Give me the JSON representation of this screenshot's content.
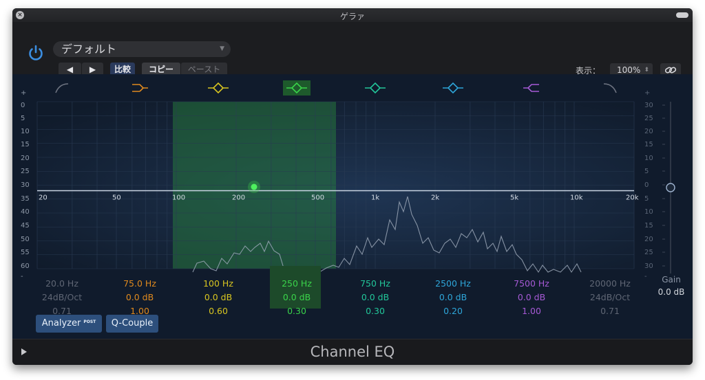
{
  "window": {
    "title": "ゲラァ"
  },
  "header": {
    "preset_name": "デフォルト",
    "prev_glyph": "◀",
    "next_glyph": "▶",
    "compare_label": "比較",
    "copy_label": "コピー",
    "paste_label": "ペースト",
    "view_label": "表示：",
    "zoom_value": "100%",
    "link_icon": "link-icon"
  },
  "graph": {
    "db_ticks": [
      "+",
      "0",
      "5",
      "10",
      "15",
      "20",
      "25",
      "30",
      "35",
      "40",
      "45",
      "50",
      "55",
      "60",
      "-"
    ],
    "gain_ticks": [
      "+",
      "30",
      "25",
      "20",
      "15",
      "10",
      "5",
      "0",
      "5",
      "10",
      "15",
      "20",
      "25",
      "30",
      "-"
    ],
    "freq_ticks": [
      "20",
      "50",
      "100",
      "200",
      "500",
      "1k",
      "2k",
      "5k",
      "10k",
      "20k"
    ],
    "highlight_color": "#2a8a3f",
    "active_band_index": 3
  },
  "bands": [
    {
      "name": "low-cut",
      "freq": "20.0 Hz",
      "gain": "24dB/Oct",
      "q": "0.71",
      "color": "#6d7380",
      "icon": "low-cut-icon"
    },
    {
      "name": "low-shelf",
      "freq": "75.0 Hz",
      "gain": "0.0 dB",
      "q": "1.00",
      "color": "#e08a1e",
      "icon": "low-shelf-icon"
    },
    {
      "name": "parametric-1",
      "freq": "100 Hz",
      "gain": "0.0 dB",
      "q": "0.60",
      "color": "#d9c620",
      "icon": "bell-icon"
    },
    {
      "name": "parametric-2",
      "freq": "250 Hz",
      "gain": "0.0 dB",
      "q": "0.30",
      "color": "#3ad44a",
      "icon": "bell-icon"
    },
    {
      "name": "parametric-3",
      "freq": "750 Hz",
      "gain": "0.0 dB",
      "q": "0.30",
      "color": "#22c79a",
      "icon": "bell-icon"
    },
    {
      "name": "parametric-4",
      "freq": "2500 Hz",
      "gain": "0.0 dB",
      "q": "0.20",
      "color": "#2ea6d9",
      "icon": "bell-icon"
    },
    {
      "name": "high-shelf",
      "freq": "7500 Hz",
      "gain": "0.0 dB",
      "q": "1.00",
      "color": "#a65ad6",
      "icon": "high-shelf-icon"
    },
    {
      "name": "high-cut",
      "freq": "20000 Hz",
      "gain": "24dB/Oct",
      "q": "0.71",
      "color": "#6d7380",
      "icon": "high-cut-icon"
    }
  ],
  "gain_control": {
    "label": "Gain",
    "value": "0.0 dB"
  },
  "toolbar": {
    "analyzer_label": "Analyzer",
    "analyzer_badge": "POST",
    "qcouple_label": "Q-Couple"
  },
  "footer": {
    "plugin_name": "Channel EQ"
  }
}
